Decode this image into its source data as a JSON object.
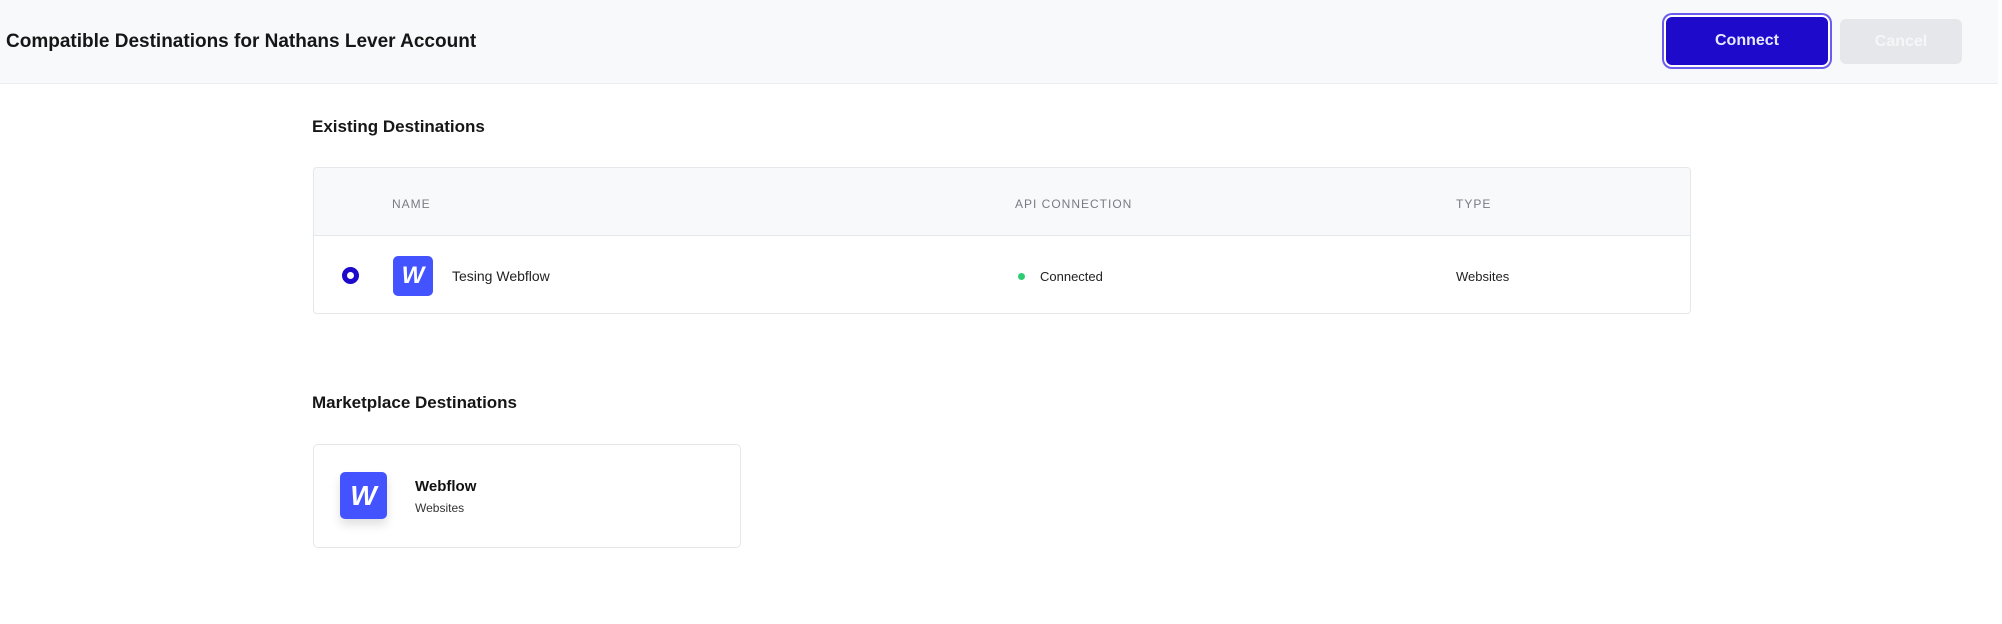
{
  "header": {
    "title": "Compatible Destinations for Nathans Lever Account",
    "connect_label": "Connect",
    "cancel_label": "Cancel"
  },
  "existing": {
    "heading": "Existing Destinations",
    "columns": [
      "NAME",
      "API CONNECTION",
      "TYPE"
    ],
    "rows": [
      {
        "name": "Tesing Webflow",
        "icon_letter": "W",
        "status": "Connected",
        "type": "Websites",
        "selected": true
      }
    ]
  },
  "marketplace": {
    "heading": "Marketplace Destinations",
    "items": [
      {
        "name": "Webflow",
        "category": "Websites",
        "icon_letter": "W"
      }
    ]
  },
  "colors": {
    "accent": "#1d0acb",
    "webflow": "#4353ff",
    "connected": "#2ecc71"
  }
}
